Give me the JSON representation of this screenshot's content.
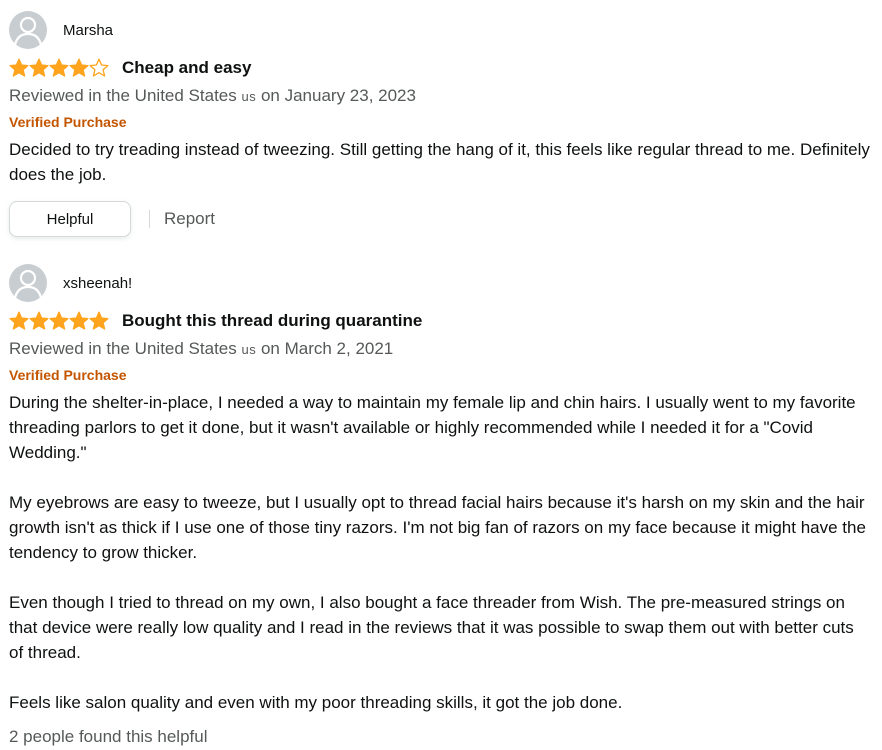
{
  "colors": {
    "star": "#ffa41c",
    "verified": "#c45500",
    "muted": "#565959"
  },
  "reviews": [
    {
      "reviewer": "Marsha",
      "rating": 4,
      "rating_max": 5,
      "title": "Cheap and easy",
      "reviewed_prefix": "Reviewed in the United States",
      "country_code": "us",
      "reviewed_date": "on January 23, 2023",
      "verified": "Verified Purchase",
      "paragraphs": [
        "Decided to try treading instead of tweezing. Still getting the hang of it, this feels like regular thread to me. Definitely does the job."
      ],
      "helpful_label": "Helpful",
      "report_label": "Report"
    },
    {
      "reviewer": "xsheenah!",
      "rating": 5,
      "rating_max": 5,
      "title": "Bought this thread during quarantine",
      "reviewed_prefix": "Reviewed in the United States",
      "country_code": "us",
      "reviewed_date": "on March 2, 2021",
      "verified": "Verified Purchase",
      "paragraphs": [
        "During the shelter-in-place, I needed a way to maintain my female lip and chin hairs. I usually went to my favorite threading parlors to get it done, but it wasn't available or highly recommended while I needed it for a \"Covid Wedding.\"",
        "My eyebrows are easy to tweeze, but I usually opt to thread facial hairs because it's harsh on my skin and the hair growth isn't as thick if I use one of those tiny razors. I'm not big fan of razors on my face because it might have the tendency to grow thicker.",
        "Even though I tried to thread on my own, I also bought a face threader from Wish. The pre-measured strings on that device were really low quality and I read in the reviews that it was possible to swap them out with better cuts of thread.",
        "Feels like salon quality and even with my poor threading skills, it got the job done."
      ],
      "found_helpful": "2 people found this helpful"
    }
  ]
}
